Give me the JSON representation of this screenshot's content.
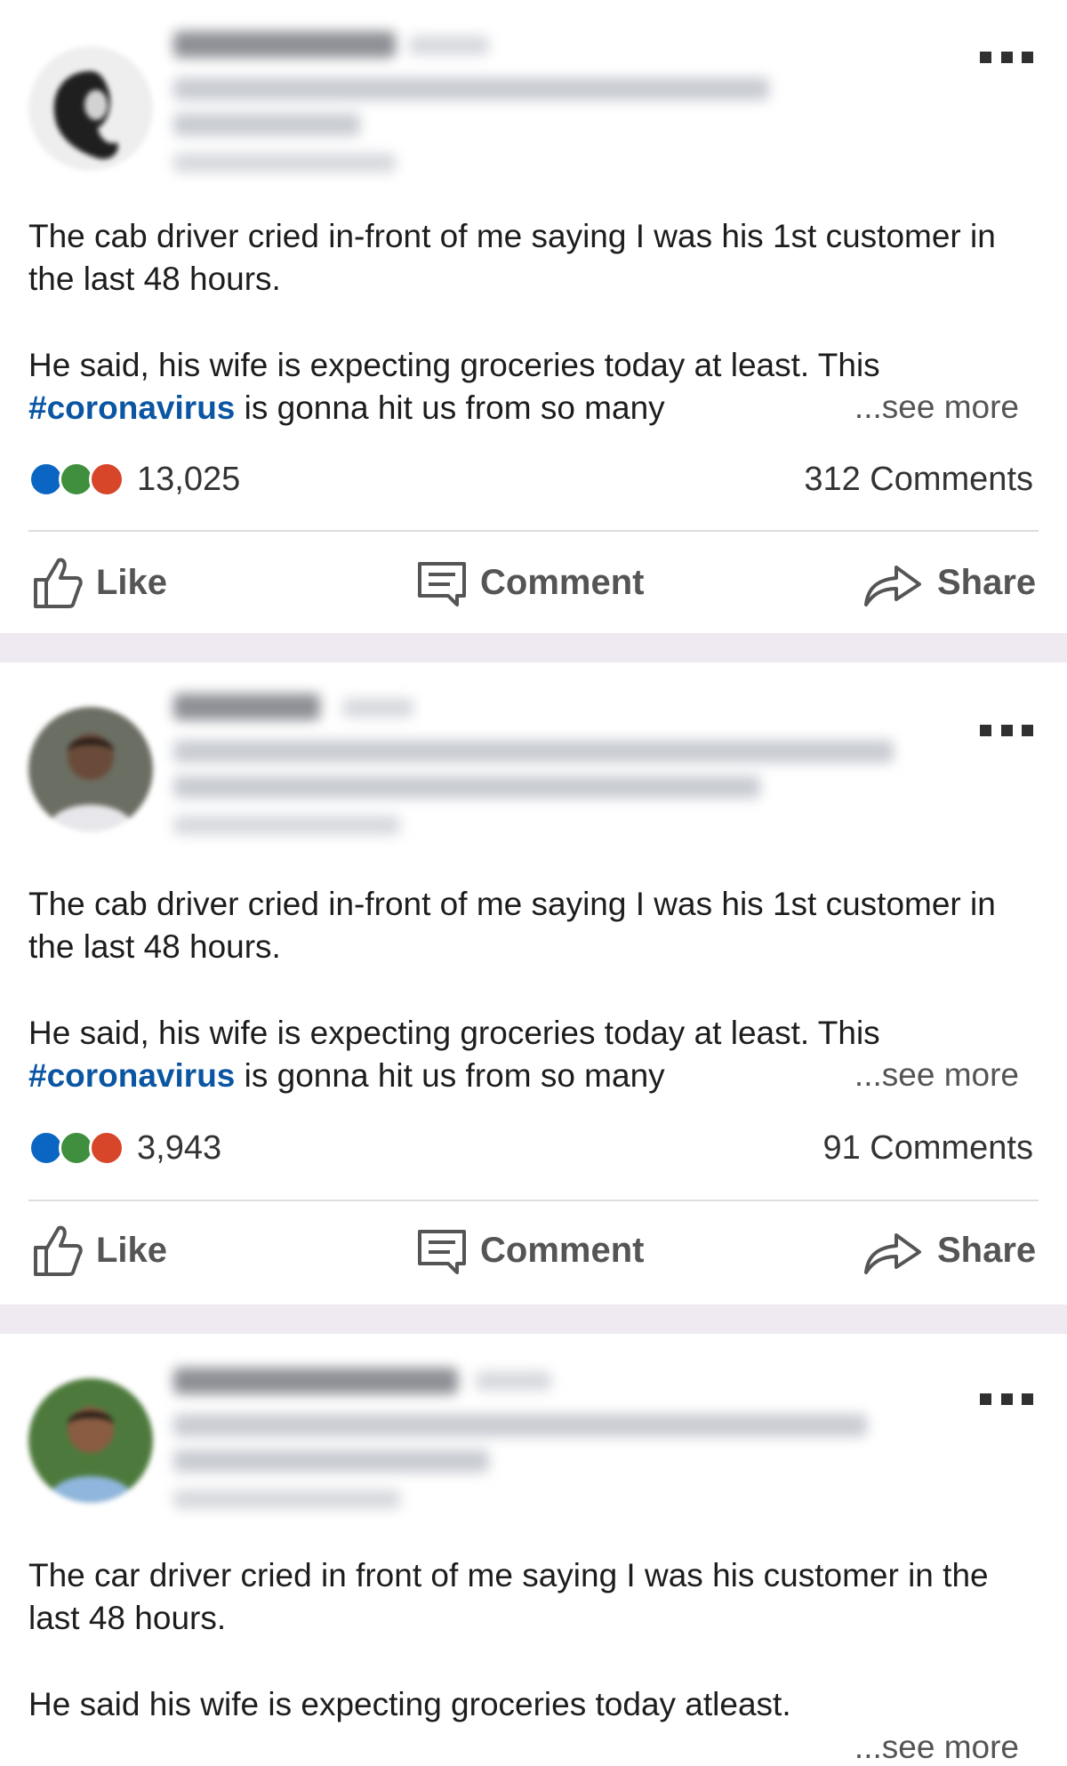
{
  "posts": [
    {
      "body_paragraph_1": "The cab driver cried in-front of me saying I was his 1st customer in the last 48 hours.",
      "body_line_2": "He said, his wife is expecting groceries today at least. This",
      "hashtag": "#coronavirus",
      "body_line_3_rest": " is gonna hit us from so many",
      "see_more": "...see more",
      "reaction_count": "13,025",
      "comments_count": "312 Comments",
      "like_label": "Like",
      "comment_label": "Comment",
      "share_label": "Share"
    },
    {
      "body_paragraph_1": "The cab driver cried in-front of me saying I was his 1st customer in the last 48 hours.",
      "body_line_2": "He said, his wife is expecting groceries today at least. This",
      "hashtag": "#coronavirus",
      "body_line_3_rest": " is gonna hit us from so many",
      "see_more": "...see more",
      "reaction_count": "3,943",
      "comments_count": "91 Comments",
      "like_label": "Like",
      "comment_label": "Comment",
      "share_label": "Share"
    },
    {
      "body_paragraph_1": "The car driver cried in front of me saying I was his customer in the last 48 hours.",
      "body_paragraph_2": "He said his wife is expecting groceries today atleast.",
      "see_more": "...see more"
    }
  ],
  "icons": {
    "like": "thumbs-up-icon",
    "comment": "comment-icon",
    "share": "share-arrow-icon",
    "more": "more-options-icon"
  },
  "colors": {
    "hashtag": "#0b56a3",
    "separator": "#efe9f1",
    "reaction_like": "#0a66c2",
    "reaction_celebrate": "#3f8f3e",
    "reaction_love": "#d8462a"
  }
}
